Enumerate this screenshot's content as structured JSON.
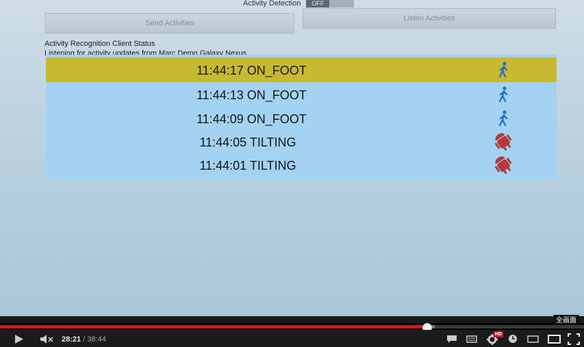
{
  "app": {
    "toggle_label": "Activity Detection",
    "toggle_state": "OFF",
    "send_button": "Send Activities",
    "listen_button": "Listen Activities",
    "status_title": "Activity Recognition Client Status",
    "status_subtitle": "Listening for activity updates from Marc Demo Galaxy Nexus"
  },
  "activity_log": [
    {
      "time": "11:44:17",
      "activity": "ON_FOOT",
      "text": "11:44:17 ON_FOOT",
      "icon": "walking-icon",
      "selected": true
    },
    {
      "time": "11:44:13",
      "activity": "ON_FOOT",
      "text": "11:44:13 ON_FOOT",
      "icon": "walking-icon",
      "selected": false
    },
    {
      "time": "11:44:09",
      "activity": "ON_FOOT",
      "text": "11:44:09 ON_FOOT",
      "icon": "walking-icon",
      "selected": false
    },
    {
      "time": "11:44:05",
      "activity": "TILTING",
      "text": "11:44:05 TILTING",
      "icon": "tilting-android-icon",
      "selected": false
    },
    {
      "time": "11:44:01",
      "activity": "TILTING",
      "text": "11:44:01 TILTING",
      "icon": "tilting-android-icon",
      "selected": false
    }
  ],
  "player": {
    "current_time": "28:21",
    "separator": " / ",
    "duration": "38:44",
    "progress_fraction": 0.7318,
    "buffered_fraction": 0.745,
    "hd_badge": "HD",
    "fullscreen_tooltip": "全画面",
    "colors": {
      "played": "#cc181e",
      "buffer": "#777777",
      "bar": "#3a3a3a"
    }
  },
  "colors": {
    "selected_row": "#c8b932",
    "list_bg": "#a4d2f2",
    "walking_icon": "#1f6fd1",
    "tilting_icon": "#b23a3a"
  }
}
